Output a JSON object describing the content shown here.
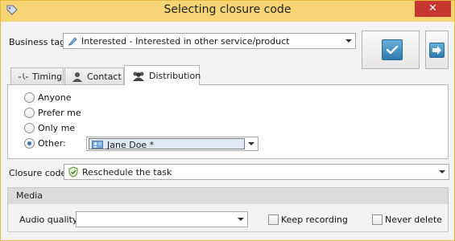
{
  "window": {
    "title": "Selecting closure code",
    "close_glyph": "✕",
    "accent": "#f7d575",
    "close_color": "#c7372f"
  },
  "business_tag": {
    "label": "Business tag",
    "value": "Interested - Interested in other service/product",
    "icon": "pencil-tag-icon"
  },
  "buttons": {
    "ok_icon": "checkmark-icon",
    "next_icon": "arrow-right-icon"
  },
  "tabs": [
    {
      "label": "Timing",
      "icon": "clock-icon",
      "active": false
    },
    {
      "label": "Contact",
      "icon": "person-icon",
      "active": false
    },
    {
      "label": "Distribution",
      "icon": "people-icon",
      "active": true
    }
  ],
  "distribution": {
    "options": [
      {
        "label": "Anyone",
        "checked": false
      },
      {
        "label": "Prefer me",
        "checked": false
      },
      {
        "label": "Only me",
        "checked": false
      },
      {
        "label": "Other:",
        "checked": true
      }
    ],
    "other_value": "Jane Doe *"
  },
  "closure_code": {
    "label": "Closure code",
    "value": "Reschedule the task",
    "icon": "shield-check-icon"
  },
  "media": {
    "group_label": "Media",
    "audio_quality_label": "Audio quality",
    "audio_quality_value": "",
    "keep_recording_label": "Keep recording",
    "keep_recording_checked": false,
    "never_delete_label": "Never delete",
    "never_delete_checked": false
  }
}
